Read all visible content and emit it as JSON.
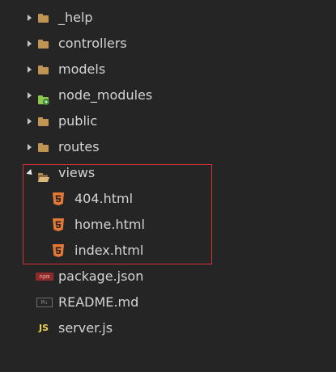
{
  "explorer": {
    "folders": [
      {
        "label": "_help",
        "icon": "folder-icon"
      },
      {
        "label": "controllers",
        "icon": "folder-icon"
      },
      {
        "label": "models",
        "icon": "folder-icon"
      },
      {
        "label": "node_modules",
        "icon": "node-folder-icon"
      },
      {
        "label": "public",
        "icon": "folder-icon"
      },
      {
        "label": "routes",
        "icon": "folder-icon"
      }
    ],
    "views": {
      "label": "views",
      "children": [
        {
          "label": "404.html"
        },
        {
          "label": "home.html"
        },
        {
          "label": "index.html"
        }
      ]
    },
    "files": [
      {
        "label": "package.json",
        "badge": "npm"
      },
      {
        "label": "README.md",
        "badge": "M↓"
      },
      {
        "label": "server.js",
        "badge": "JS"
      }
    ]
  },
  "colors": {
    "background": "#252526",
    "folder": "#c09553",
    "html_icon": "#e37933",
    "highlight_border": "#d6303a",
    "node_green": "#8cc84b",
    "js_yellow": "#e8d44d"
  }
}
